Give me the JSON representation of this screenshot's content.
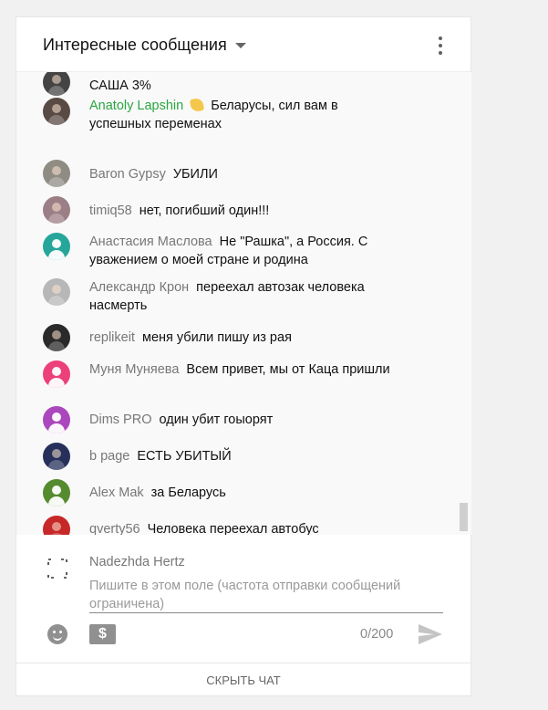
{
  "header": {
    "title": "Интересные сообщения"
  },
  "messages": [
    {
      "author": "",
      "text": "САША 3%",
      "avatar_color": "#444444"
    },
    {
      "author": "Anatoly Lapshin",
      "text": "Беларусы, сил вам в успешных переменах",
      "owner": true,
      "avatar_color": "#5a4a44"
    },
    {
      "author": "Baron Gypsy",
      "text": "УБИЛИ",
      "avatar_color": "#8f8c84"
    },
    {
      "author": "timiq58",
      "text": "нет, погибший один!!!",
      "avatar_color": "#9c7f86"
    },
    {
      "author": "Анастасия Маслова",
      "text": "Не \"Рашка\", а Россия. С уважением о моей стране и родина",
      "avatar_color": "#26a69a"
    },
    {
      "author": "Александр Крон",
      "text": "переехал автозак человека насмерть",
      "avatar_color": "#b7b7b7"
    },
    {
      "author": "replikeit",
      "text": "меня убили пишу из рая",
      "avatar_color": "#2a2a2a"
    },
    {
      "author": "Муня Муняева",
      "text": "Всем привет, мы от Каца пришли",
      "avatar_color": "#ec407a"
    },
    {
      "author": "Dims PRO",
      "text": "один убит гоыорят",
      "avatar_color": "#ab47bc"
    },
    {
      "author": "b page",
      "text": "ЕСТЬ УБИТЫЙ",
      "avatar_color": "#26305a"
    },
    {
      "author": "Alex Mak",
      "text": "за Беларусь",
      "avatar_color": "#558b2f"
    },
    {
      "author": "qverty56",
      "text": "Человека переехал автобус",
      "avatar_color": "#c62828"
    }
  ],
  "composer": {
    "name": "Nadezhda Hertz",
    "placeholder": "Пишите в этом поле (частота отправки сообщений ограничена)",
    "counter": "0/200",
    "money_symbol": "$"
  },
  "footer": {
    "hide_chat": "СКРЫТЬ ЧАТ"
  },
  "icons": {
    "caret": "chevron-down-icon",
    "menu": "more-vert-icon",
    "emoji": "emoji-icon",
    "money": "super-chat-icon",
    "send": "send-icon"
  },
  "colors": {
    "owner_name": "#2ba640",
    "author_name": "#777777",
    "scroll_thumb": "#cfcfcf",
    "panel_bg": "#f9f9f9"
  }
}
